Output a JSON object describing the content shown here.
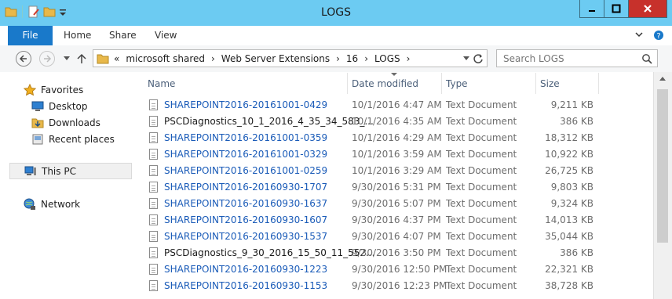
{
  "window": {
    "title": "LOGS"
  },
  "ribbon": {
    "tabs": [
      "File",
      "Home",
      "Share",
      "View"
    ]
  },
  "address": {
    "chevrons": "«",
    "segments": [
      "microsoft shared",
      "Web Server Extensions",
      "16",
      "LOGS"
    ]
  },
  "search": {
    "placeholder": "Search LOGS"
  },
  "nav": {
    "favorites": "Favorites",
    "items": [
      "Desktop",
      "Downloads",
      "Recent places"
    ],
    "this_pc": "This PC",
    "network": "Network"
  },
  "columns": {
    "name": "Name",
    "date": "Date modified",
    "type": "Type",
    "size": "Size"
  },
  "files": [
    {
      "name": "SHAREPOINT2016-20161001-0429",
      "date": "10/1/2016 4:47 AM",
      "type": "Text Document",
      "size": "9,211 KB",
      "link": true
    },
    {
      "name": "PSCDiagnostics_10_1_2016_4_35_34_583_...",
      "date": "10/1/2016 4:35 AM",
      "type": "Text Document",
      "size": "386 KB",
      "link": false
    },
    {
      "name": "SHAREPOINT2016-20161001-0359",
      "date": "10/1/2016 4:29 AM",
      "type": "Text Document",
      "size": "18,312 KB",
      "link": true
    },
    {
      "name": "SHAREPOINT2016-20161001-0329",
      "date": "10/1/2016 3:59 AM",
      "type": "Text Document",
      "size": "10,922 KB",
      "link": true
    },
    {
      "name": "SHAREPOINT2016-20161001-0259",
      "date": "10/1/2016 3:29 AM",
      "type": "Text Document",
      "size": "26,725 KB",
      "link": true
    },
    {
      "name": "SHAREPOINT2016-20160930-1707",
      "date": "9/30/2016 5:31 PM",
      "type": "Text Document",
      "size": "9,803 KB",
      "link": true
    },
    {
      "name": "SHAREPOINT2016-20160930-1637",
      "date": "9/30/2016 5:07 PM",
      "type": "Text Document",
      "size": "9,324 KB",
      "link": true
    },
    {
      "name": "SHAREPOINT2016-20160930-1607",
      "date": "9/30/2016 4:37 PM",
      "type": "Text Document",
      "size": "14,013 KB",
      "link": true
    },
    {
      "name": "SHAREPOINT2016-20160930-1537",
      "date": "9/30/2016 4:07 PM",
      "type": "Text Document",
      "size": "35,044 KB",
      "link": true
    },
    {
      "name": "PSCDiagnostics_9_30_2016_15_50_11_552...",
      "date": "9/30/2016 3:50 PM",
      "type": "Text Document",
      "size": "386 KB",
      "link": false
    },
    {
      "name": "SHAREPOINT2016-20160930-1223",
      "date": "9/30/2016 12:50 PM",
      "type": "Text Document",
      "size": "22,321 KB",
      "link": true
    },
    {
      "name": "SHAREPOINT2016-20160930-1153",
      "date": "9/30/2016 12:23 PM",
      "type": "Text Document",
      "size": "38,728 KB",
      "link": true
    }
  ]
}
